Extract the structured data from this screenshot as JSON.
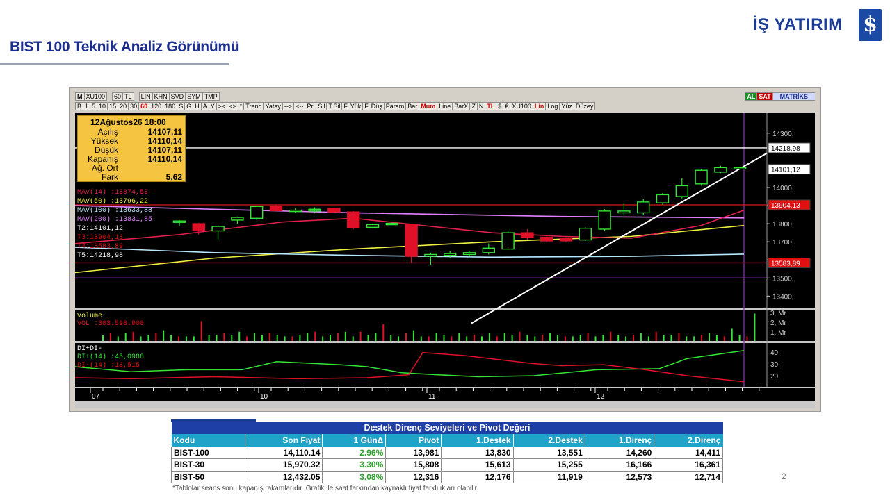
{
  "header": {
    "title": "BIST 100 Teknik Analiz Görünümü",
    "brand": "İŞ YATIRIM",
    "brand_glyph": "$",
    "brand_color": "#1b3c96"
  },
  "toolbar": {
    "row1": [
      "M",
      "XU100",
      "60",
      "TL",
      "LIN",
      "KHN",
      "SVD",
      "SYM",
      "TMP"
    ],
    "row1_right": [
      "AL",
      "SAT",
      "MATRİKS"
    ],
    "row2": [
      "B",
      "1",
      "5",
      "10",
      "15",
      "20",
      "30",
      "60",
      "120",
      "180",
      "S",
      "G",
      "H",
      "A",
      "Y",
      "><",
      "<>",
      "*",
      "Trend",
      "Yatay",
      "-->",
      "<--",
      "Prl",
      "Sil",
      "T.Sil",
      "F. Yük",
      "F. Düş",
      "Param",
      "Bar",
      "Mum",
      "Line",
      "BarX",
      "Z",
      "N",
      "TL",
      "$",
      "€",
      "XU100",
      "Lin",
      "Log",
      "Yüz",
      "Düzey"
    ],
    "active_period": "60",
    "active_style": "Mum"
  },
  "info_panel": {
    "date": "12Ağustos26 18:00",
    "rows": [
      {
        "label": "Açılış",
        "value": "14107,11"
      },
      {
        "label": "Yüksek",
        "value": "14110,14"
      },
      {
        "label": "Düşük",
        "value": "14107,11"
      },
      {
        "label": "Kapanış",
        "value": "14110,14"
      },
      {
        "label": "Ağ. Ort",
        "value": ""
      },
      {
        "label": "Fark",
        "value": "5,62"
      }
    ]
  },
  "indicators": {
    "mav14": "MAV(14)     :13874,53",
    "mav50": "MAV(50)     :13796,22",
    "mav100": "MAV(100)    :13633,88",
    "mav200": "MAV(200)    :13831,85",
    "t2": "T2:14101,12",
    "t3": "T3:13904,13",
    "t4": "T4:13583,89",
    "t5": "T5:14218,98",
    "volume_title": "Volume",
    "vol": "VOL    :303.598.900",
    "di_title": "DI+DI-",
    "di_plus": "DI+(14)    :45,0988",
    "di_minus": "DI-(14)    :13,515"
  },
  "price_axis": {
    "ticks": [
      "14300,",
      "14000,",
      "13900,",
      "13800,",
      "13700,",
      "13600,",
      "13500,",
      "13400,"
    ],
    "tags": [
      {
        "text": "14218,98",
        "bg": "#ffffff",
        "fg": "#000000"
      },
      {
        "text": "14101,12",
        "bg": "#ffffff",
        "fg": "#000000"
      },
      {
        "text": "13904,13",
        "bg": "#e01010",
        "fg": "#ffffff"
      },
      {
        "text": "13583,89",
        "bg": "#e01010",
        "fg": "#ffffff"
      }
    ]
  },
  "volume_axis": [
    "3, Mr",
    "2, Mr",
    "1, Mr"
  ],
  "di_axis": [
    "40,",
    "30,",
    "20,"
  ],
  "date_axis": [
    "07",
    "10",
    "11",
    "12"
  ],
  "colors": {
    "bull": "#33e633",
    "bear": "#e01028",
    "mav14": "#e0204a",
    "mav50": "#f0f040",
    "mav100": "#b8e8ff",
    "mav200": "#e080ff",
    "trend": "#ffffff",
    "resistance": "#d81818",
    "support_purple": "#9a2ad0"
  },
  "candles": [
    {
      "o": 13810,
      "h": 13820,
      "l": 13790,
      "c": 13815
    },
    {
      "o": 13800,
      "h": 13805,
      "l": 13740,
      "c": 13765
    },
    {
      "o": 13760,
      "h": 13790,
      "l": 13710,
      "c": 13785
    },
    {
      "o": 13820,
      "h": 13840,
      "l": 13800,
      "c": 13835
    },
    {
      "o": 13830,
      "h": 13900,
      "l": 13820,
      "c": 13895
    },
    {
      "o": 13898,
      "h": 13905,
      "l": 13870,
      "c": 13872
    },
    {
      "o": 13870,
      "h": 13885,
      "l": 13860,
      "c": 13875
    },
    {
      "o": 13870,
      "h": 13890,
      "l": 13860,
      "c": 13880
    },
    {
      "o": 13885,
      "h": 13890,
      "l": 13860,
      "c": 13865
    },
    {
      "o": 13865,
      "h": 13870,
      "l": 13770,
      "c": 13780
    },
    {
      "o": 13780,
      "h": 13800,
      "l": 13775,
      "c": 13795
    },
    {
      "o": 13800,
      "h": 13805,
      "l": 13795,
      "c": 13802
    },
    {
      "o": 13795,
      "h": 13800,
      "l": 13580,
      "c": 13620
    },
    {
      "o": 13620,
      "h": 13640,
      "l": 13570,
      "c": 13630
    },
    {
      "o": 13625,
      "h": 13650,
      "l": 13610,
      "c": 13635
    },
    {
      "o": 13630,
      "h": 13650,
      "l": 13620,
      "c": 13640
    },
    {
      "o": 13640,
      "h": 13690,
      "l": 13630,
      "c": 13665
    },
    {
      "o": 13660,
      "h": 13760,
      "l": 13655,
      "c": 13750
    },
    {
      "o": 13750,
      "h": 13770,
      "l": 13710,
      "c": 13725
    },
    {
      "o": 13725,
      "h": 13730,
      "l": 13700,
      "c": 13705
    },
    {
      "o": 13720,
      "h": 13725,
      "l": 13700,
      "c": 13705
    },
    {
      "o": 13710,
      "h": 13780,
      "l": 13705,
      "c": 13775
    },
    {
      "o": 13770,
      "h": 13880,
      "l": 13760,
      "c": 13870
    },
    {
      "o": 13860,
      "h": 13910,
      "l": 13850,
      "c": 13870
    },
    {
      "o": 13860,
      "h": 13935,
      "l": 13850,
      "c": 13920
    },
    {
      "o": 13915,
      "h": 13970,
      "l": 13905,
      "c": 13960
    },
    {
      "o": 13950,
      "h": 14050,
      "l": 13940,
      "c": 14010
    },
    {
      "o": 14020,
      "h": 14100,
      "l": 14010,
      "c": 14095
    },
    {
      "o": 14085,
      "h": 14120,
      "l": 14080,
      "c": 14110
    },
    {
      "o": 14107,
      "h": 14111,
      "l": 14107,
      "c": 14110
    }
  ],
  "volume_bars": [
    0.4,
    0.5,
    0.3,
    0.5,
    0.6,
    0.3,
    0.4,
    0.5,
    0.7,
    0.4,
    0.3,
    0.3,
    0.3,
    1.3,
    0.4,
    0.4,
    0.5,
    0.4,
    0.6,
    0.3,
    0.5,
    0.4,
    0.5,
    0.4,
    0.3,
    0.3,
    0.4,
    0.5,
    0.6,
    0.3,
    0.4,
    0.5,
    0.6,
    0.3,
    0.6,
    0.4,
    0.5,
    1.1,
    0.4,
    0.3,
    0.5,
    0.7,
    0.3,
    0.3,
    0.5,
    0.4,
    0.3,
    0.5,
    0.3,
    0.4,
    0.3,
    0.5,
    0.3,
    0.5,
    0.4,
    0.6,
    0.4,
    0.3,
    0.4,
    0.5,
    0.4,
    0.3,
    0.3,
    0.4,
    0.5,
    0.3,
    0.4,
    0.6,
    0.4,
    0.3,
    0.4,
    0.5,
    0.3,
    0.6,
    0.4,
    0.4,
    0.5,
    0.3,
    0.3,
    0.4,
    0.5,
    0.4,
    0.3,
    0.8,
    0.4,
    0.3,
    1.8
  ],
  "table": {
    "caption": "Destek Direnç Seviyeleri ve Pivot Değeri",
    "columns": [
      "Kodu",
      "Son Fiyat",
      "1 GünΔ",
      "Pivot",
      "1.Destek",
      "2.Destek",
      "1.Direnç",
      "2.Direnç"
    ],
    "rows": [
      [
        "BIST-100",
        "14,110.14",
        "2.96%",
        "13,981",
        "13,830",
        "13,551",
        "14,260",
        "14,411"
      ],
      [
        "BIST-30",
        "15,970.32",
        "3.30%",
        "15,808",
        "15,613",
        "15,255",
        "16,166",
        "16,361"
      ],
      [
        "BIST-50",
        "12,432.05",
        "3.08%",
        "12,316",
        "12,176",
        "11,919",
        "12,573",
        "12,714"
      ]
    ],
    "footnote": "*Tablolar seans sonu kapanış rakamlarıdır. Grafik ile saat farkından kaynaklı fiyat farklılıkları olabilir."
  },
  "page_number": "2"
}
